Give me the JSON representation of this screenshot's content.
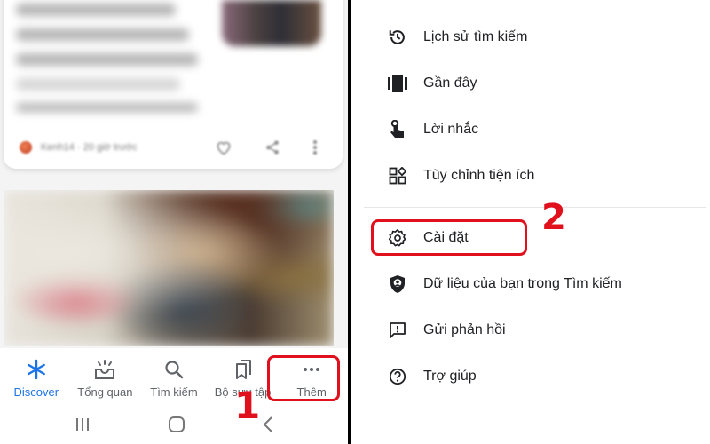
{
  "feed": {
    "card1": {
      "source": "Kenh14 · 20 giờ trước",
      "actions": [
        {
          "icon": "heart-icon"
        },
        {
          "icon": "share-icon"
        },
        {
          "icon": "more-vert-icon"
        }
      ]
    }
  },
  "bottom_nav": {
    "items": [
      {
        "label": "Discover",
        "icon": "asterisk-icon",
        "active": true
      },
      {
        "label": "Tổng quan",
        "icon": "sunrise-inbox-icon",
        "active": false
      },
      {
        "label": "Tìm kiếm",
        "icon": "search-icon",
        "active": false
      },
      {
        "label": "Bộ sưu tập",
        "icon": "bookmarks-icon",
        "active": false
      },
      {
        "label": "Thêm",
        "icon": "more-horiz-icon",
        "active": false
      }
    ]
  },
  "system_nav": {
    "items": [
      {
        "icon": "recents-icon"
      },
      {
        "icon": "home-icon"
      },
      {
        "icon": "back-icon"
      }
    ]
  },
  "menu": {
    "items": [
      {
        "label": "Lịch sử tìm kiếm",
        "icon": "history-icon"
      },
      {
        "label": "Gần đây",
        "icon": "carousel-icon"
      },
      {
        "label": "Lời nhắc",
        "icon": "reminder-hand-icon"
      },
      {
        "label": "Tùy chỉnh tiện ích",
        "icon": "widgets-icon"
      },
      {
        "label": "Cài đặt",
        "icon": "gear-icon"
      },
      {
        "label": "Dữ liệu của bạn trong Tìm kiếm",
        "icon": "shield-person-icon"
      },
      {
        "label": "Gửi phản hồi",
        "icon": "feedback-icon"
      },
      {
        "label": "Trợ giúp",
        "icon": "help-icon"
      }
    ]
  },
  "annotations": {
    "step1": "1",
    "step2": "2",
    "color": "#e0101c"
  },
  "colors": {
    "accent": "#1a73e8",
    "icon": "#5f6368",
    "text": "#202124"
  }
}
